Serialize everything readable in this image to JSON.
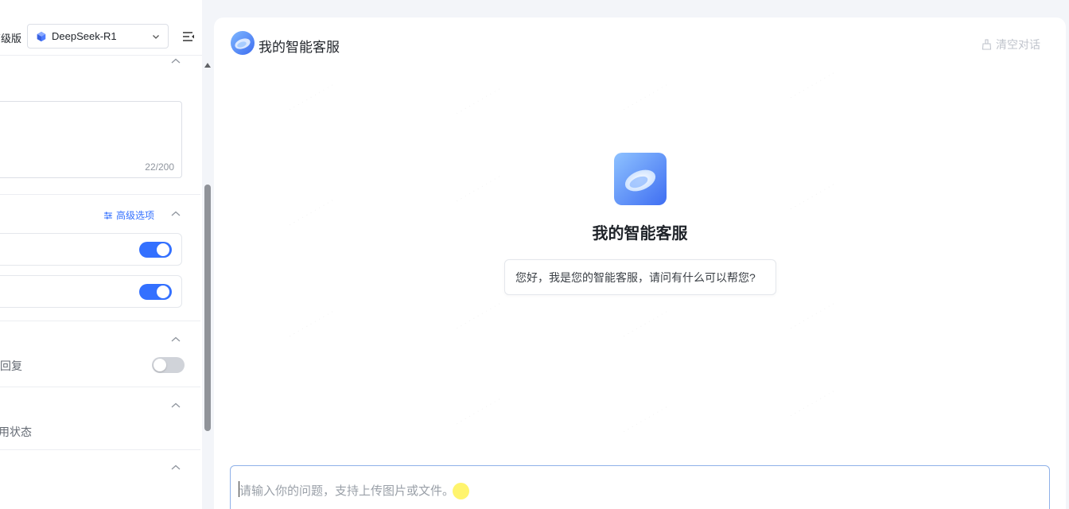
{
  "left_panel": {
    "edition": "高级版",
    "model": "DeepSeek-R1",
    "char_counter": "22/200",
    "advanced_options_label": "高级选项",
    "switch_1_on": true,
    "switch_2_on": true,
    "reply_label_fragment": "回复",
    "reply_switch_on": false,
    "status_label_fragment": "用状态"
  },
  "chat": {
    "title": "我的智能客服",
    "clear_label": "清空对话",
    "center_title": "我的智能客服",
    "greeting": "您好，我是您的智能客服，请问有什么可以帮您?",
    "input_placeholder": "请输入你的问题，支持上传图片或文件。"
  },
  "colors": {
    "accent": "#3370ff",
    "switch_off": "#d0d3d9",
    "background": "#f3f5f9"
  }
}
